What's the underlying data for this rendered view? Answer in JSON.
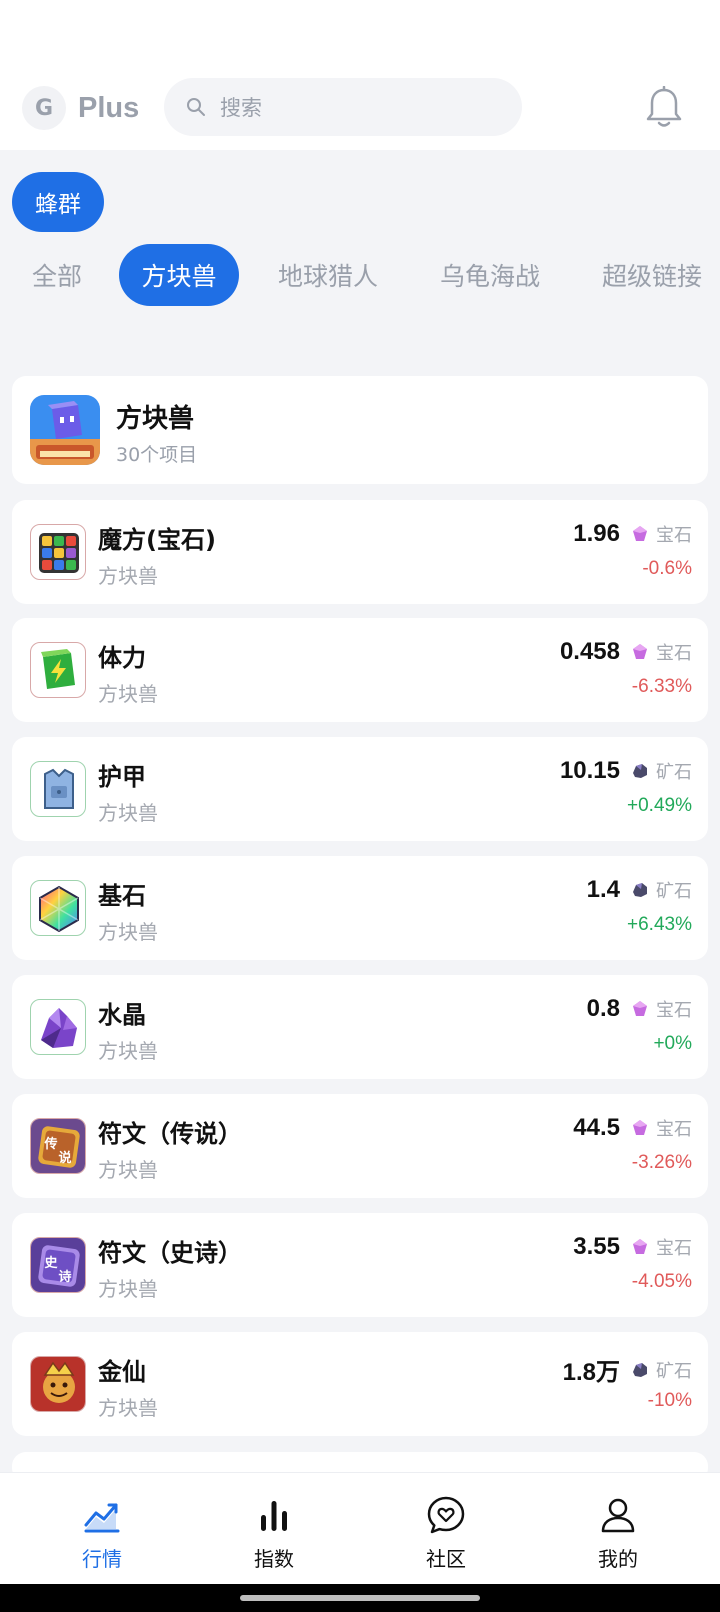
{
  "app": {
    "logo_letter": "G",
    "logo_text": "Plus"
  },
  "search": {
    "placeholder": "搜索"
  },
  "group": {
    "label": "蜂群"
  },
  "tabs": [
    {
      "label": "全部",
      "active": false
    },
    {
      "label": "方块兽",
      "active": true
    },
    {
      "label": "地球猎人",
      "active": false
    },
    {
      "label": "乌龟海战",
      "active": false
    },
    {
      "label": "超级链接",
      "active": false
    }
  ],
  "game": {
    "name": "方块兽",
    "count": "30个项目"
  },
  "items": [
    {
      "name": "魔方(宝石)",
      "sub": "方块兽",
      "price": "1.96",
      "currency": "宝石",
      "change": "-0.6%",
      "trend": "neg"
    },
    {
      "name": "体力",
      "sub": "方块兽",
      "price": "0.458",
      "currency": "宝石",
      "change": "-6.33%",
      "trend": "neg"
    },
    {
      "name": "护甲",
      "sub": "方块兽",
      "price": "10.15",
      "currency": "矿石",
      "change": "+0.49%",
      "trend": "pos"
    },
    {
      "name": "基石",
      "sub": "方块兽",
      "price": "1.4",
      "currency": "矿石",
      "change": "+6.43%",
      "trend": "pos"
    },
    {
      "name": "水晶",
      "sub": "方块兽",
      "price": "0.8",
      "currency": "宝石",
      "change": "+0%",
      "trend": "pos"
    },
    {
      "name": "符文（传说）",
      "sub": "方块兽",
      "price": "44.5",
      "currency": "宝石",
      "change": "-3.26%",
      "trend": "neg"
    },
    {
      "name": "符文（史诗）",
      "sub": "方块兽",
      "price": "3.55",
      "currency": "宝石",
      "change": "-4.05%",
      "trend": "neg"
    },
    {
      "name": "金仙",
      "sub": "方块兽",
      "price": "1.8万",
      "currency": "矿石",
      "change": "-10%",
      "trend": "neg"
    }
  ],
  "icon_badges": {
    "legend": "传说",
    "epic": "史诗"
  },
  "nav": [
    {
      "label": "行情",
      "icon": "chart-trend-icon",
      "active": true
    },
    {
      "label": "指数",
      "icon": "bar-index-icon",
      "active": false
    },
    {
      "label": "社区",
      "icon": "community-heart-icon",
      "active": false
    },
    {
      "label": "我的",
      "icon": "profile-icon",
      "active": false
    }
  ],
  "colors": {
    "accent": "#1f6fe5",
    "negative": "#e05a5a",
    "positive": "#22a95a",
    "muted": "#9aa0ab",
    "background": "#f3f4f7"
  }
}
